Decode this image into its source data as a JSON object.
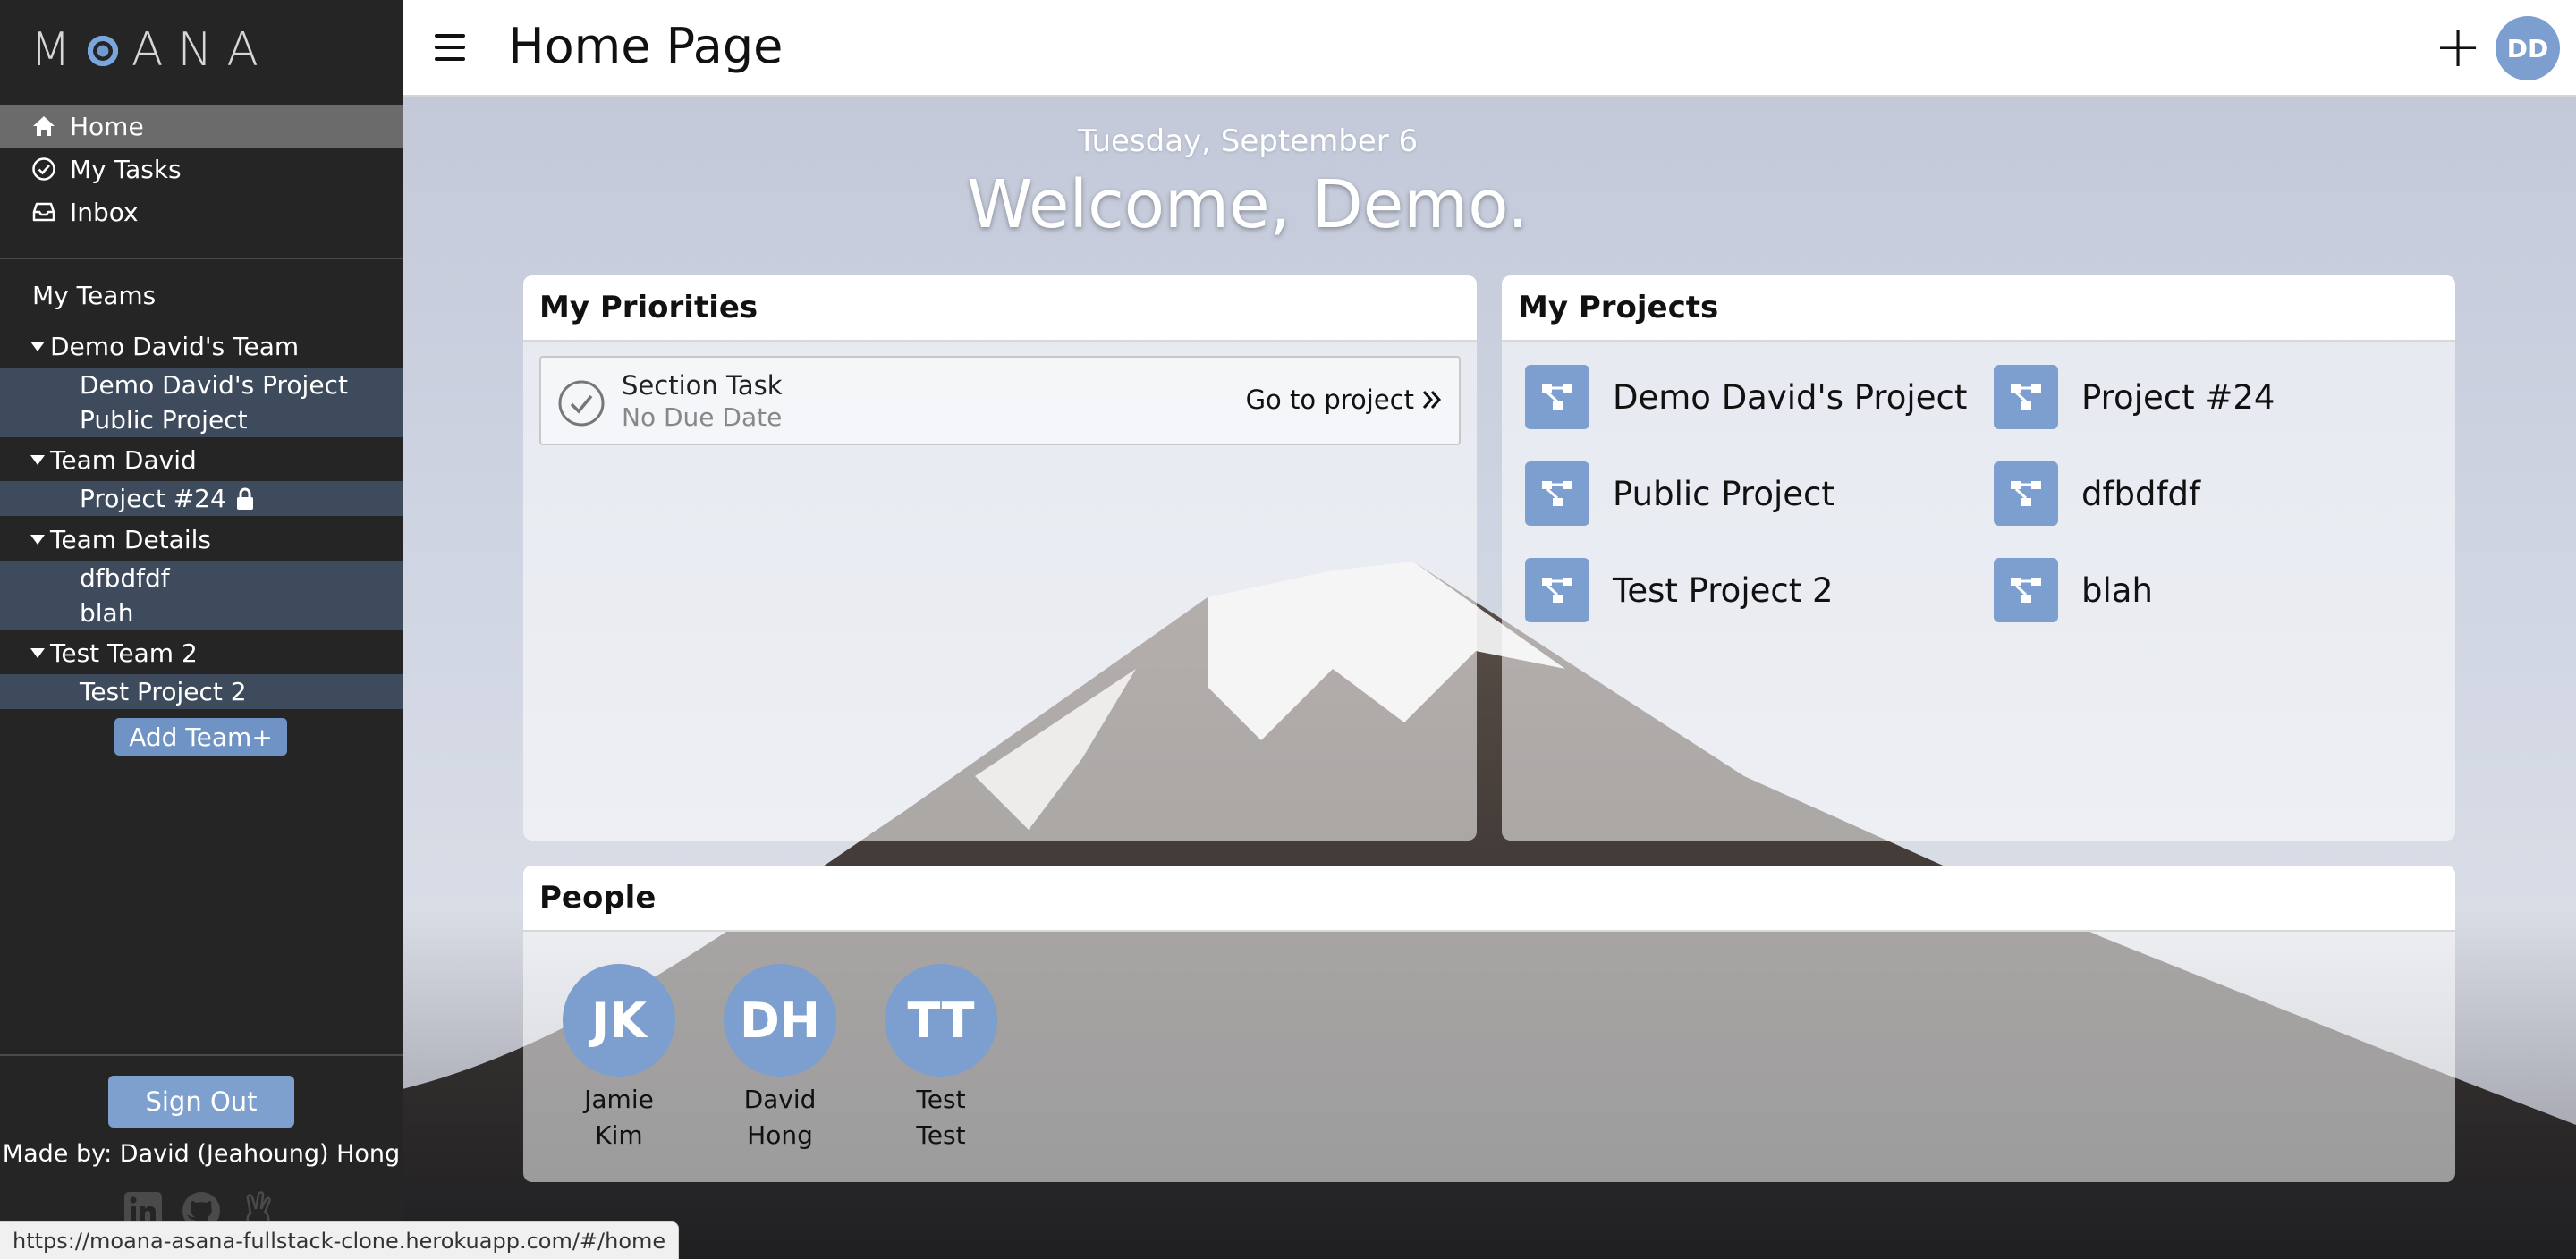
{
  "sidebar": {
    "logo": "M    ANA",
    "nav": [
      {
        "label": "Home",
        "icon": "home-icon"
      },
      {
        "label": "My Tasks",
        "icon": "check-circle-icon"
      },
      {
        "label": "Inbox",
        "icon": "inbox-icon"
      }
    ],
    "my_teams_label": "My Teams",
    "teams": [
      {
        "name": "Demo David's Team",
        "projects": [
          "Demo David's Project",
          "Public Project"
        ]
      },
      {
        "name": "Team David",
        "projects": [
          "Project #24"
        ]
      },
      {
        "name": "Team Details",
        "projects": [
          "dfbdfdf",
          "blah"
        ]
      },
      {
        "name": "Test Team 2",
        "projects": [
          "Test Project 2"
        ]
      }
    ],
    "add_team_label": "Add Team+",
    "sign_out_label": "Sign Out",
    "made_by": "Made by: David (Jeahoung) Hong"
  },
  "header": {
    "title": "Home Page",
    "add_label": "+",
    "avatar_initials": "DD"
  },
  "main": {
    "date": "Tuesday, September 6",
    "welcome": "Welcome, Demo."
  },
  "priorities": {
    "title": "My Priorities",
    "tasks": [
      {
        "title": "Section Task",
        "due": "No Due Date",
        "link_label": "Go to project"
      }
    ]
  },
  "projects": {
    "title": "My Projects",
    "items": [
      "Demo David's Project",
      "Project #24",
      "Public Project",
      "dfbdfdf",
      "Test Project 2",
      "blah"
    ]
  },
  "people": {
    "title": "People",
    "members": [
      {
        "initials": "JK",
        "first": "Jamie",
        "last": "Kim"
      },
      {
        "initials": "DH",
        "first": "David",
        "last": "Hong"
      },
      {
        "initials": "TT",
        "first": "Test",
        "last": "Test"
      }
    ]
  },
  "status_bar": {
    "url": "https://moana-asana-fullstack-clone.herokuapp.com/#/home"
  },
  "colors": {
    "sidebar_bg": "#252525",
    "accent": "#7c9fcf",
    "active_nav": "#6b6b6b",
    "project_block": "#3e4b5c"
  }
}
